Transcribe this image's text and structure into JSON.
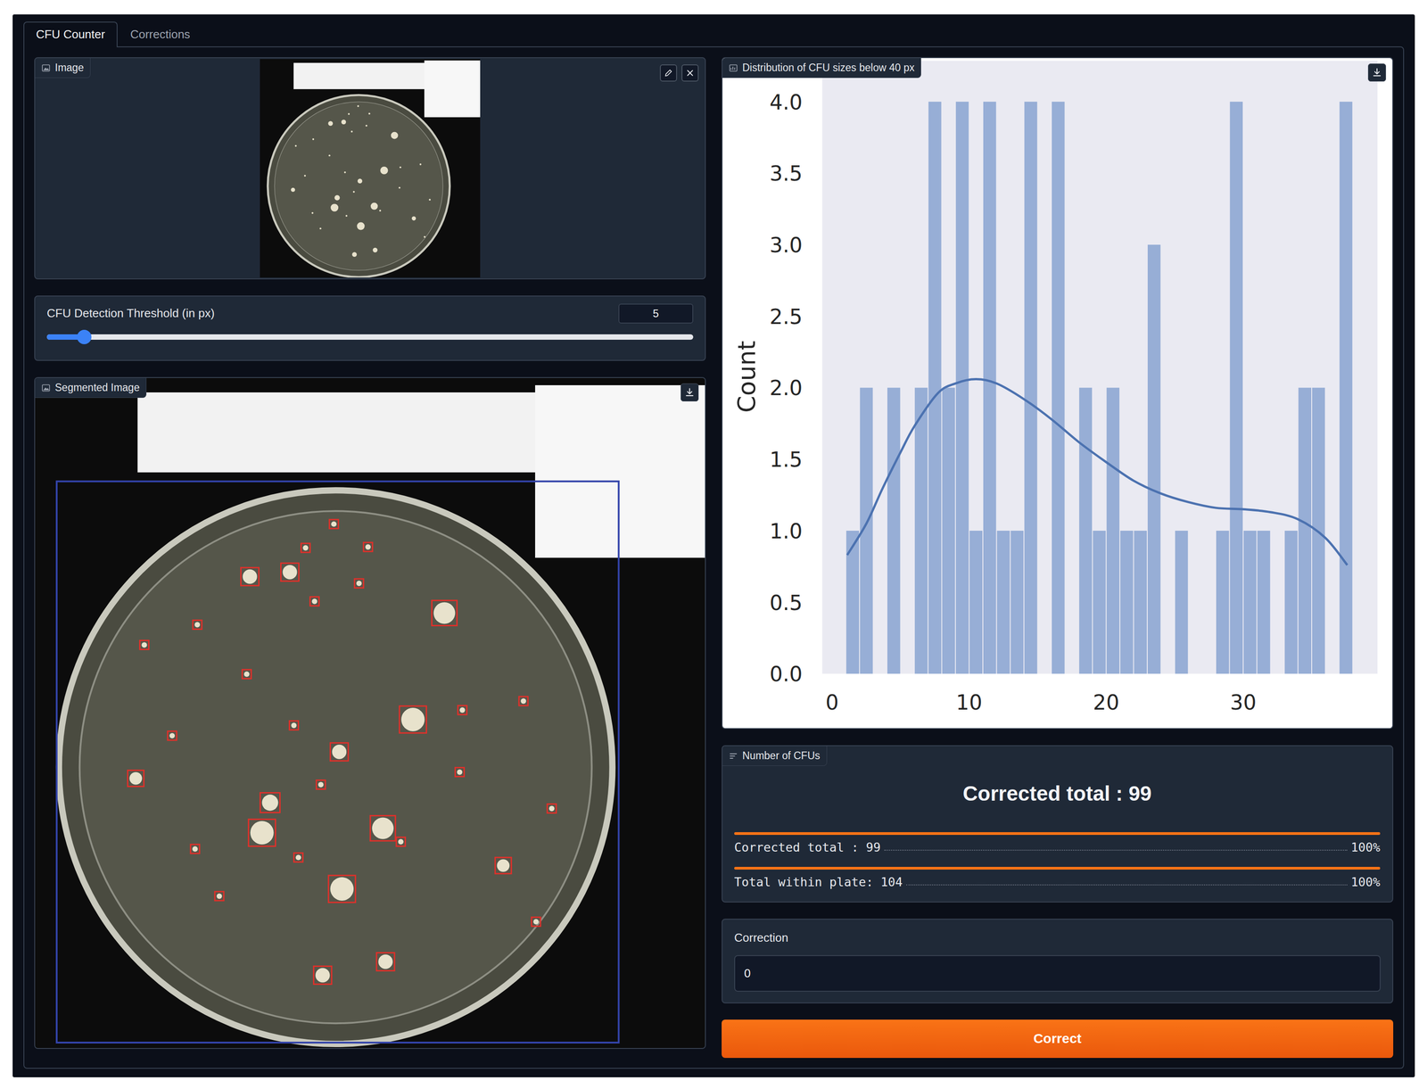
{
  "tabs": [
    {
      "label": "CFU Counter",
      "selected": true
    },
    {
      "label": "Corrections",
      "selected": false
    }
  ],
  "image_panel": {
    "label": "Image"
  },
  "slider": {
    "label": "CFU Detection Threshold (in px)",
    "value": "5",
    "level": 0.058
  },
  "segmented_panel": {
    "label": "Segmented Image"
  },
  "chart": {
    "title": "Distribution of CFU sizes below 40 px",
    "y_label": "Count",
    "y_ticks": [
      "0.0",
      "0.5",
      "1.0",
      "1.5",
      "2.0",
      "2.5",
      "3.0",
      "3.5",
      "4.0"
    ],
    "x_ticks": [
      "0",
      "10",
      "20",
      "30"
    ],
    "bin_start": 1,
    "bin_width": 1,
    "counts": [
      1,
      2,
      0,
      2,
      0,
      2,
      4,
      2,
      4,
      1,
      4,
      1,
      1,
      4,
      0,
      4,
      0,
      2,
      1,
      2,
      1,
      1,
      3,
      0,
      1,
      0,
      0,
      1,
      4,
      1,
      1,
      0,
      1,
      2,
      2,
      0,
      4
    ],
    "kde": {
      "x": [
        1.1,
        2.5,
        3.7,
        5.0,
        6.0,
        7.7,
        9.0,
        10.5,
        12.0,
        14.0,
        16.0,
        18.0,
        20.0,
        22.0,
        24.0,
        26.0,
        28.0,
        30.0,
        32.0,
        34.0,
        36.0,
        37.6
      ],
      "y": [
        0.83,
        1.05,
        1.3,
        1.55,
        1.73,
        1.96,
        2.03,
        2.06,
        2.03,
        1.92,
        1.78,
        1.62,
        1.48,
        1.35,
        1.26,
        1.2,
        1.16,
        1.15,
        1.13,
        1.08,
        0.95,
        0.76
      ]
    }
  },
  "counts_panel": {
    "label": "Number of CFUs",
    "headline": "Corrected total : 99",
    "rows": [
      {
        "label": "Corrected total : 99",
        "reading": "100%",
        "level": 1.0
      },
      {
        "label": "Total within plate: 104",
        "reading": "100%",
        "level": 1.0
      }
    ]
  },
  "correction": {
    "label": "Correction",
    "value": "0"
  },
  "button": {
    "label": "Correct"
  }
}
